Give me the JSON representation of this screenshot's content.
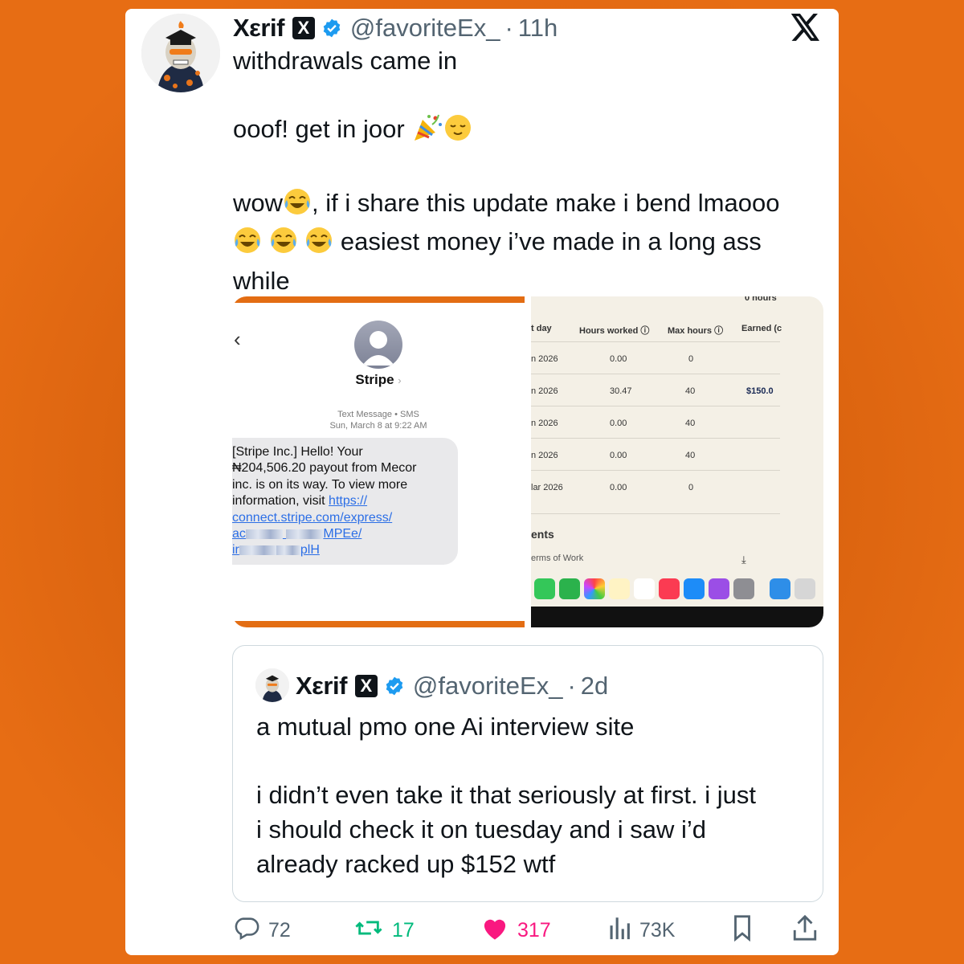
{
  "tweet": {
    "author_name": "Xεrif",
    "x_badge": "X",
    "handle": "@favoriteEx_",
    "separator": "·",
    "time": "11h",
    "lines": [
      "withdrawals came in",
      "",
      "ooof! get in joor",
      "",
      "wow",
      ", if i share this update make i bend lmaooo",
      "easiest money i’ve made in a long ass",
      "while"
    ]
  },
  "sms": {
    "sender": "Stripe",
    "chevron": "›",
    "meta_type": "Text Message • SMS",
    "meta_date": "Sun, March 8 at 9:22 AM",
    "message_lines": [
      "[Stripe Inc.] Hello! Your",
      "₦204,506.20 payout from Mecor",
      "inc. is on its way. To view more",
      "information, visit "
    ],
    "link_1": "https://",
    "link_2": "connect.stripe.com/express/",
    "link_3_prefix": "ac",
    "link_3_suffix": "MPEe/",
    "link_4_prefix": "ir",
    "link_4_suffix": "plH"
  },
  "table": {
    "top_label": "0 hours",
    "headers": [
      "t day",
      "Hours worked ⓘ",
      "Max hours ⓘ",
      "Earned (c"
    ],
    "rows": [
      [
        "n 2026",
        "0.00",
        "0",
        ""
      ],
      [
        "n 2026",
        "30.47",
        "40",
        "$150.0"
      ],
      [
        "n 2026",
        "0.00",
        "40",
        ""
      ],
      [
        "n 2026",
        "0.00",
        "40",
        ""
      ],
      [
        "lar 2026",
        "0.00",
        "0",
        ""
      ]
    ],
    "section_label": "ents",
    "footer_item": "erms of Work"
  },
  "quote": {
    "author_name": "Xεrif",
    "x_badge": "X",
    "handle": "@favoriteEx_",
    "separator": "·",
    "time": "2d",
    "lines": [
      "a mutual pmo one Ai interview site",
      "",
      "i didn’t even take it that seriously at first. i just",
      "i should check it on tuesday and i saw i’d",
      "already racked up $152 wtf"
    ]
  },
  "actions": {
    "replies": "72",
    "reposts": "17",
    "likes": "317",
    "views": "73K"
  },
  "colors": {
    "background": "#e76d14",
    "verified": "#1d9bf0",
    "repost": "#00ba7c",
    "like": "#f91880",
    "muted": "#536471"
  },
  "icons": [
    "verified-icon",
    "x-logo-icon",
    "reply-icon",
    "repost-icon",
    "heart-icon",
    "views-icon",
    "bookmark-icon",
    "share-icon",
    "party-popper-icon",
    "relieved-face-icon",
    "joy-emoji-icon"
  ]
}
